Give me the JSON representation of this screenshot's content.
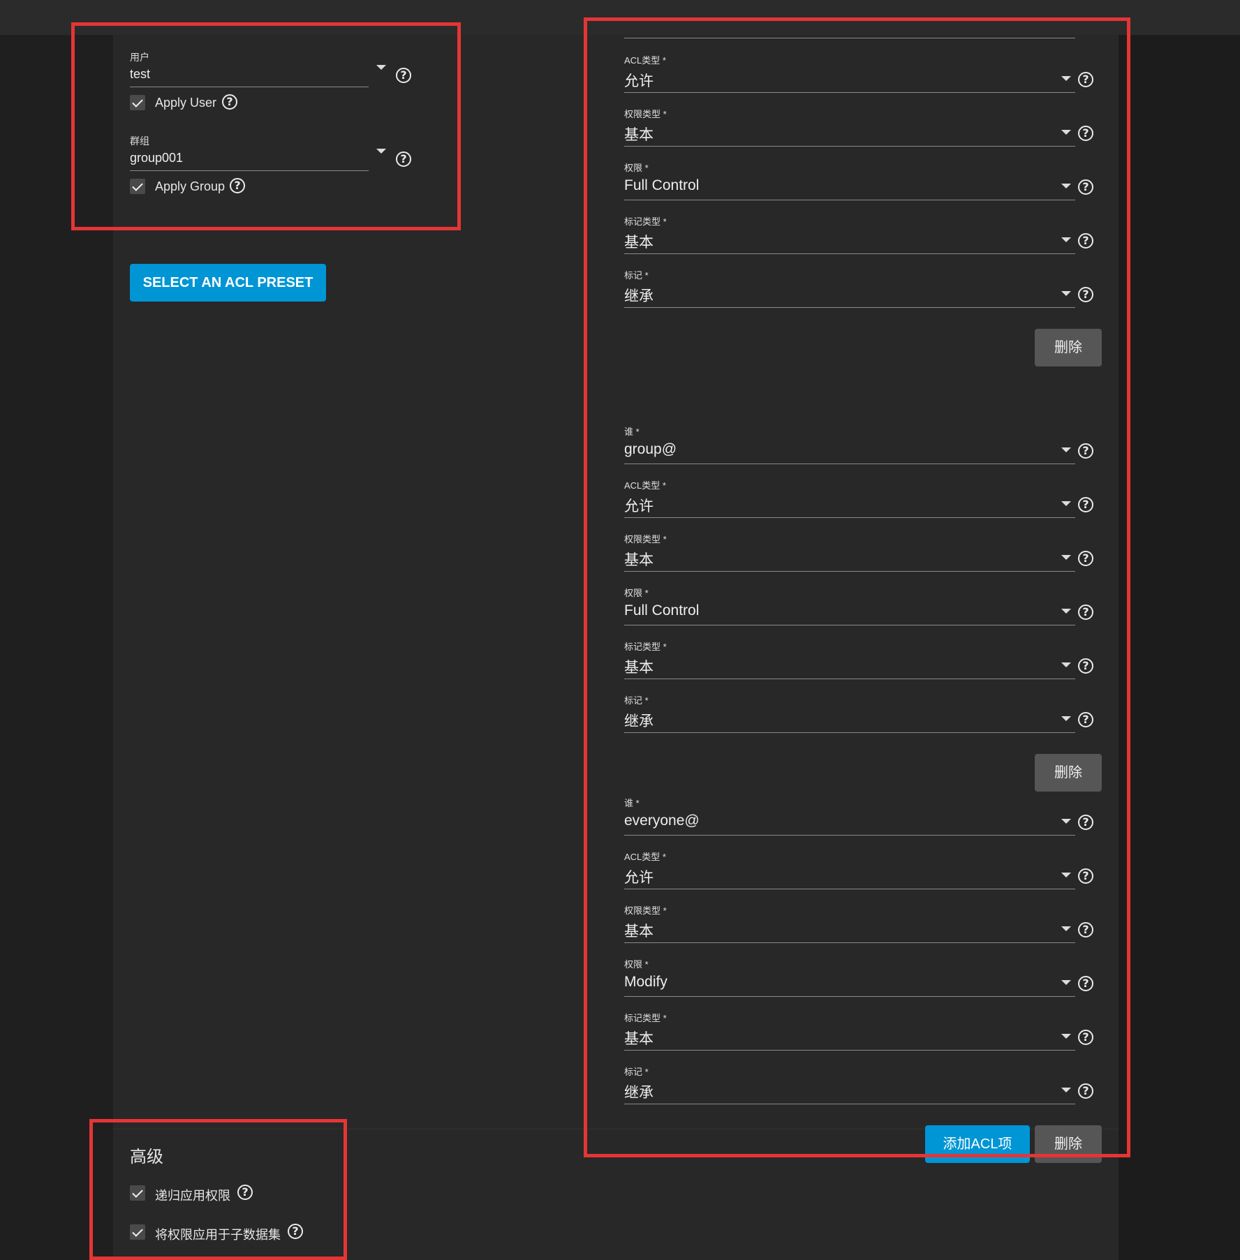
{
  "owner": {
    "user_label": "用户",
    "user_value": "test",
    "apply_user_label": "Apply User",
    "group_label": "群组",
    "group_value": "group001",
    "apply_group_label": "Apply Group"
  },
  "preset_button": "SELECT AN ACL PRESET",
  "acl_entries": [
    {
      "fields": [
        {
          "label": "ACL类型 *",
          "value": "允许"
        },
        {
          "label": "权限类型 *",
          "value": "基本"
        },
        {
          "label": "权限 *",
          "value": "Full Control"
        },
        {
          "label": "标记类型 *",
          "value": "基本"
        },
        {
          "label": "标记 *",
          "value": "继承"
        }
      ],
      "delete_label": "删除"
    },
    {
      "fields": [
        {
          "label": "谁 *",
          "value": "group@"
        },
        {
          "label": "ACL类型 *",
          "value": "允许"
        },
        {
          "label": "权限类型 *",
          "value": "基本"
        },
        {
          "label": "权限 *",
          "value": "Full Control"
        },
        {
          "label": "标记类型 *",
          "value": "基本"
        },
        {
          "label": "标记 *",
          "value": "继承"
        }
      ],
      "delete_label": "删除"
    },
    {
      "fields": [
        {
          "label": "谁 *",
          "value": "everyone@"
        },
        {
          "label": "ACL类型 *",
          "value": "允许"
        },
        {
          "label": "权限类型 *",
          "value": "基本"
        },
        {
          "label": "权限 *",
          "value": "Modify"
        },
        {
          "label": "标记类型 *",
          "value": "基本"
        },
        {
          "label": "标记 *",
          "value": "继承"
        }
      ],
      "delete_label": "删除"
    }
  ],
  "add_acl_button": "添加ACL项",
  "advanced": {
    "title": "高级",
    "recursive_label": "递归应用权限",
    "apply_children_label": "将权限应用于子数据集"
  },
  "colors": {
    "accent": "#0095d5",
    "highlight_box": "#e53535",
    "background": "#1f1f1f",
    "panel": "#282828"
  }
}
